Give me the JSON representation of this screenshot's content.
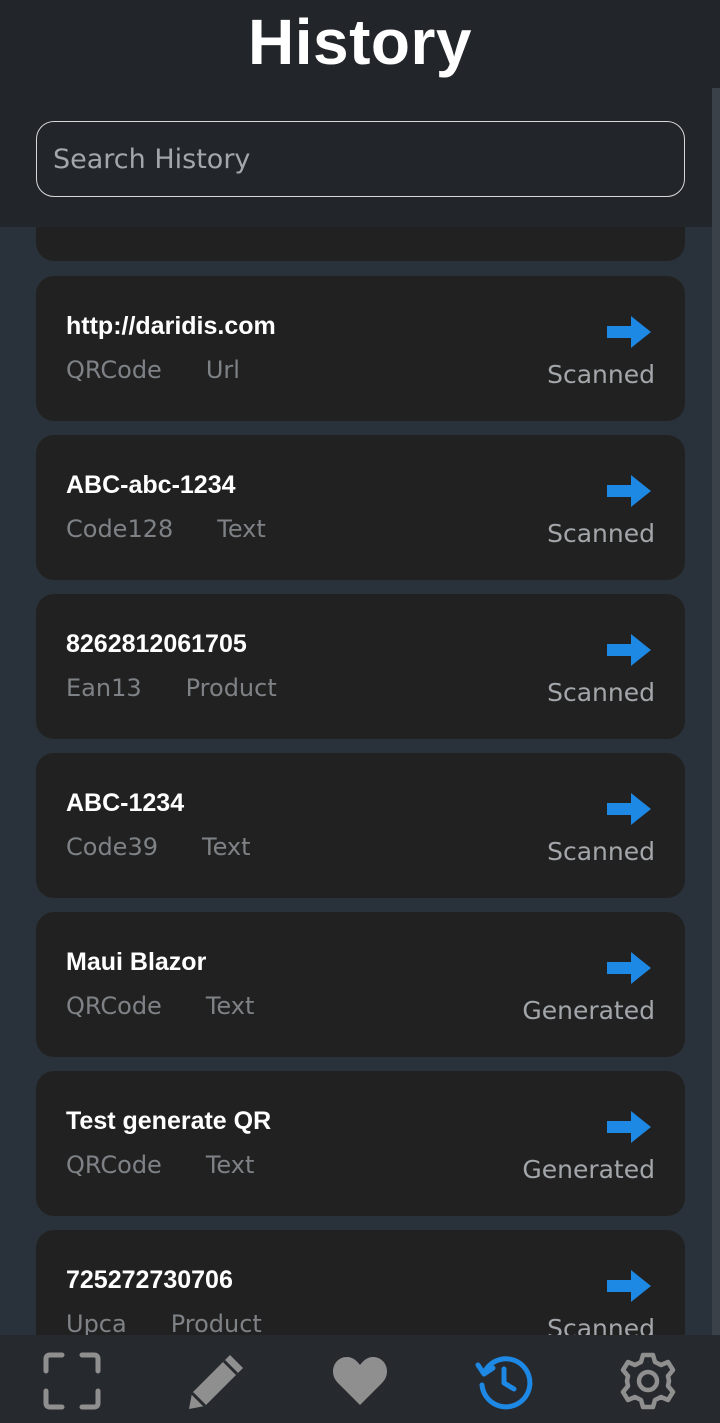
{
  "header": {
    "title": "History",
    "search_placeholder": "Search History"
  },
  "items": [
    {
      "value": "http://daridis.com",
      "format": "QRCode",
      "type": "Url",
      "status": "Scanned",
      "icon": "arrow-right-icon"
    },
    {
      "value": "ABC-abc-1234",
      "format": "Code128",
      "type": "Text",
      "status": "Scanned",
      "icon": "arrow-right-icon"
    },
    {
      "value": "8262812061705",
      "format": "Ean13",
      "type": "Product",
      "status": "Scanned",
      "icon": "arrow-right-icon"
    },
    {
      "value": "ABC-1234",
      "format": "Code39",
      "type": "Text",
      "status": "Scanned",
      "icon": "arrow-right-icon"
    },
    {
      "value": "Maui Blazor",
      "format": "QRCode",
      "type": "Text",
      "status": "Generated",
      "icon": "arrow-right-icon"
    },
    {
      "value": "Test generate QR",
      "format": "QRCode",
      "type": "Text",
      "status": "Generated",
      "icon": "arrow-right-icon"
    },
    {
      "value": "725272730706",
      "format": "Upca",
      "type": "Product",
      "status": "Scanned",
      "icon": "arrow-right-icon"
    }
  ],
  "nav": [
    {
      "name": "scan",
      "icon": "scan-frame-icon",
      "active": false
    },
    {
      "name": "generate",
      "icon": "pencil-icon",
      "active": false
    },
    {
      "name": "favorites",
      "icon": "heart-icon",
      "active": false
    },
    {
      "name": "history",
      "icon": "history-icon",
      "active": true
    },
    {
      "name": "settings",
      "icon": "gear-icon",
      "active": false
    }
  ],
  "colors": {
    "accent": "#1e88e5",
    "icon_inactive": "#8f8f8f",
    "card_bg": "#212121",
    "page_bg": "#29323a",
    "header_bg": "#22262a"
  }
}
